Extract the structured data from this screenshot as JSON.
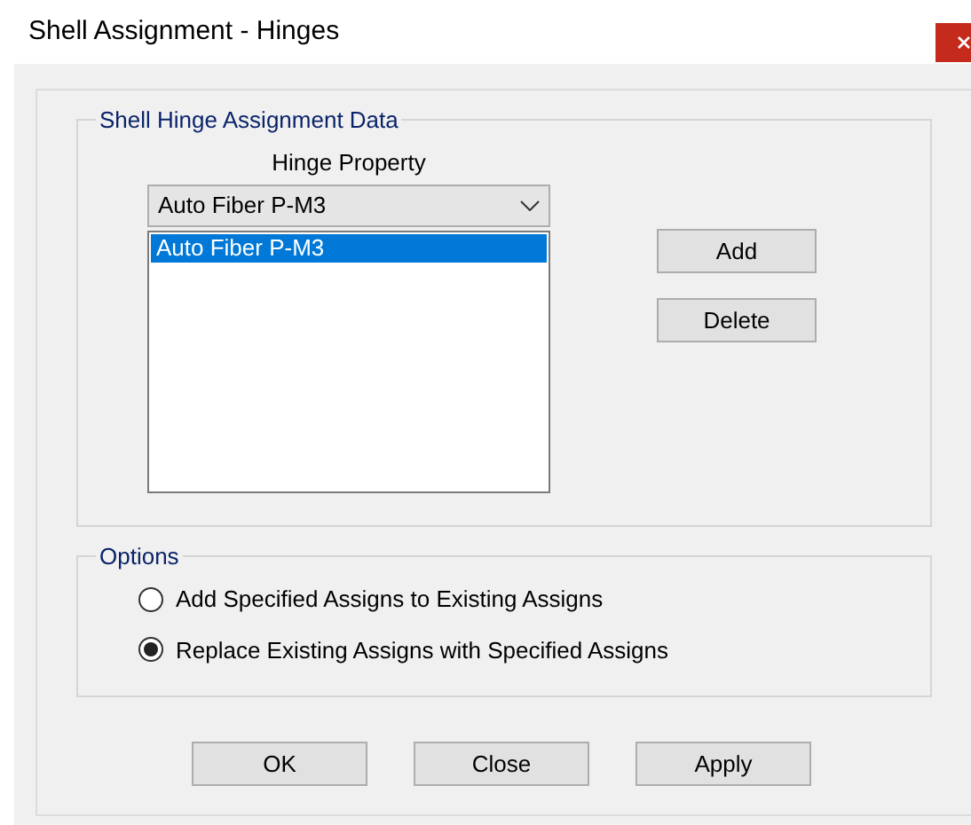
{
  "window": {
    "title": "Shell Assignment - Hinges"
  },
  "data_group": {
    "title": "Shell Hinge Assignment Data",
    "property_label": "Hinge Property",
    "dropdown_value": "Auto Fiber P-M3",
    "list_items": [
      {
        "label": "Auto  Fiber P-M3",
        "selected": true
      }
    ],
    "buttons": [
      "Add",
      "Delete"
    ]
  },
  "options": {
    "title": "Options",
    "radios": [
      {
        "label": "Add Specified Assigns to Existing Assigns",
        "selected": false
      },
      {
        "label": "Replace Existing Assigns with Specified Assigns",
        "selected": true
      }
    ]
  },
  "buttons": [
    "OK",
    "Close",
    "Apply"
  ]
}
